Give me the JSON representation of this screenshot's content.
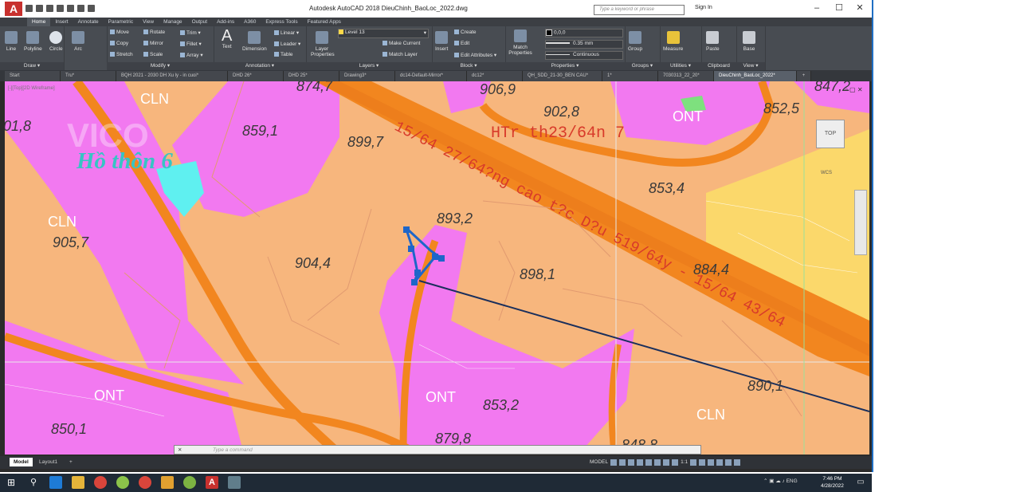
{
  "window": {
    "title": "Autodesk AutoCAD 2018    DieuChinh_BaoLoc_2022.dwg",
    "search_placeholder": "Type a keyword or phrase",
    "sign_in": "Sign In",
    "app_icon_letter": "A"
  },
  "menu_tabs": [
    "Home",
    "Insert",
    "Annotate",
    "Parametric",
    "View",
    "Manage",
    "Output",
    "Add-ins",
    "A360",
    "Express Tools",
    "Featured Apps"
  ],
  "ribbon": {
    "draw": {
      "title": "Draw ▾",
      "line": "Line",
      "polyline": "Polyline",
      "circle": "Circle",
      "arc": "Arc"
    },
    "modify": {
      "title": "Modify ▾",
      "move": "Move",
      "rotate": "Rotate",
      "trim": "Trim ▾",
      "copy": "Copy",
      "mirror": "Mirror",
      "fillet": "Fillet ▾",
      "stretch": "Stretch",
      "scale": "Scale",
      "array": "Array ▾"
    },
    "annotation": {
      "title": "Annotation ▾",
      "text": "Text",
      "dimension": "Dimension",
      "linear": "Linear ▾",
      "leader": "Leader ▾",
      "table": "Table"
    },
    "layers": {
      "title": "Layers ▾",
      "layer_properties": "Layer Properties",
      "layer_name": "Level 13",
      "make_current": "Make Current",
      "match_layer": "Match Layer"
    },
    "block": {
      "title": "Block ▾",
      "insert": "Insert",
      "create": "Create",
      "edit": "Edit",
      "edit_attributes": "Edit Attributes ▾"
    },
    "properties": {
      "title": "Properties ▾",
      "match_properties": "Match Properties",
      "color": "0,0,0",
      "lineweight": "0.35 mm",
      "linetype": "Continuous"
    },
    "groups": {
      "title": "Groups ▾",
      "group": "Group"
    },
    "utilities": {
      "title": "Utilities ▾",
      "measure": "Measure"
    },
    "clipboard": {
      "title": "Clipboard",
      "paste": "Paste"
    },
    "view": {
      "title": "View ▾",
      "base": "Base"
    }
  },
  "doc_tabs": [
    "Start",
    "Tru*",
    "BQH 2021 - 2030 DH Xu ly - in cuoi*",
    "DHD 26*",
    "DHD 25*",
    "Drawing3*",
    "dc14-Default-Mirror*",
    "dc12*",
    "QH_SDD_21-30_BEN CAU*",
    "1*",
    "7030313_22_20*",
    "DieuChinh_BaoLoc_2022*"
  ],
  "active_doc_tab": "DieuChinh_BaoLoc_2022*",
  "viewport": {
    "label": "[-][Top][2D Wireframe]",
    "navcube": "TOP",
    "wcs": "WCS",
    "watermark": "VICO",
    "place_name": "Hồ thôn 6",
    "road_text": "HTr th23/64n 7",
    "diagonal_text": "15/64 27/64?ng cao t?c D?u 519/64y - 15/64 43/64"
  },
  "map_labels": {
    "elevations": [
      "01,8",
      "859,1",
      "874,7",
      "906,9",
      "902,8",
      "852,5",
      "847,2",
      "899,7",
      "853,4",
      "905,7",
      "904,4",
      "893,2",
      "898,1",
      "884,4",
      "890,1",
      "853,2",
      "850,1",
      "879,8",
      "848,8"
    ],
    "zones": [
      "CLN",
      "CLN",
      "ONT",
      "ONT",
      "ONT",
      "CLN"
    ]
  },
  "command_line": {
    "placeholder": "Type a command",
    "close": "✕"
  },
  "layout_tabs": [
    "Model",
    "Layout1",
    "+"
  ],
  "status": {
    "model": "MODEL",
    "scale": "1:1"
  },
  "taskbar": {
    "time": "7:46 PM",
    "date": "4/28/2022",
    "lang": "ENG"
  },
  "colors": {
    "orange_land": "#f7b67d",
    "road": "#f2861f",
    "pink": "#f279f0",
    "yellow": "#fbd86b",
    "cyan": "#5ff0f0",
    "blue_polyline": "#1e66c9"
  }
}
